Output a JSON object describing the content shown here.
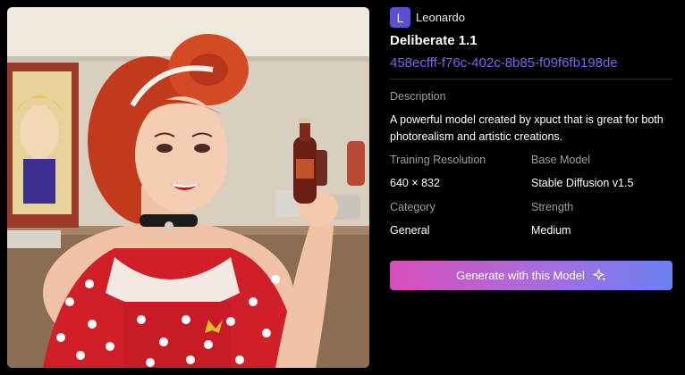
{
  "preview": {
    "icon": "generated-image-sample",
    "alt_subject": "pin-up illustration"
  },
  "brand": {
    "initial": "L",
    "name": "Leonardo"
  },
  "model": {
    "name": "Deliberate 1.1",
    "id": "458ecfff-f76c-402c-8b85-f09f6fb198de"
  },
  "description": {
    "label": "Description",
    "text": "A powerful model created by xpuct that is great for both photorealism and artistic creations."
  },
  "specs": {
    "training_resolution": {
      "label": "Training Resolution",
      "value": "640 × 832"
    },
    "base_model": {
      "label": "Base Model",
      "value": "Stable Diffusion v1.5"
    },
    "category": {
      "label": "Category",
      "value": "General"
    },
    "strength": {
      "label": "Strength",
      "value": "Medium"
    }
  },
  "action": {
    "label": "Generate with this Model",
    "icon": "sparkle-icon"
  },
  "colors": {
    "accent": "#7b63ee",
    "button_start": "#d84fb9",
    "button_end": "#6b81f1",
    "background": "#000000"
  }
}
